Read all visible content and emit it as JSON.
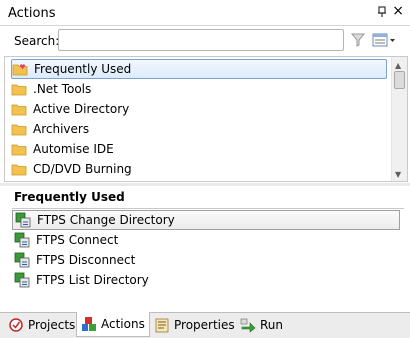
{
  "panel": {
    "title": "Actions"
  },
  "search": {
    "label": "Search:",
    "value": "",
    "placeholder": ""
  },
  "folders": [
    {
      "label": "Frequently Used",
      "icon": "favorites-folder-icon",
      "selected": true
    },
    {
      "label": ".Net Tools",
      "icon": "folder-icon",
      "selected": false
    },
    {
      "label": "Active Directory",
      "icon": "folder-icon",
      "selected": false
    },
    {
      "label": "Archivers",
      "icon": "folder-icon",
      "selected": false
    },
    {
      "label": "Automise IDE",
      "icon": "folder-icon",
      "selected": false
    },
    {
      "label": "CD/DVD Burning",
      "icon": "folder-icon",
      "selected": false
    }
  ],
  "actions_section": {
    "heading": "Frequently Used",
    "items": [
      {
        "label": "FTPS Change Directory",
        "icon": "ftps-action-icon",
        "selected": true
      },
      {
        "label": "FTPS Connect",
        "icon": "ftps-action-icon",
        "selected": false
      },
      {
        "label": "FTPS Disconnect",
        "icon": "ftps-action-icon",
        "selected": false
      },
      {
        "label": "FTPS List Directory",
        "icon": "ftps-action-icon",
        "selected": false
      }
    ]
  },
  "tabs": [
    {
      "label": "Projects",
      "icon": "projects-icon",
      "active": false
    },
    {
      "label": "Actions",
      "icon": "actions-icon",
      "active": true
    },
    {
      "label": "Properties",
      "icon": "properties-icon",
      "active": false
    },
    {
      "label": "Run",
      "icon": "run-icon",
      "active": false
    }
  ],
  "colors": {
    "selection_border": "#7da2ce",
    "folder": "#f2c14e",
    "accent_green": "#2e8b2e"
  }
}
